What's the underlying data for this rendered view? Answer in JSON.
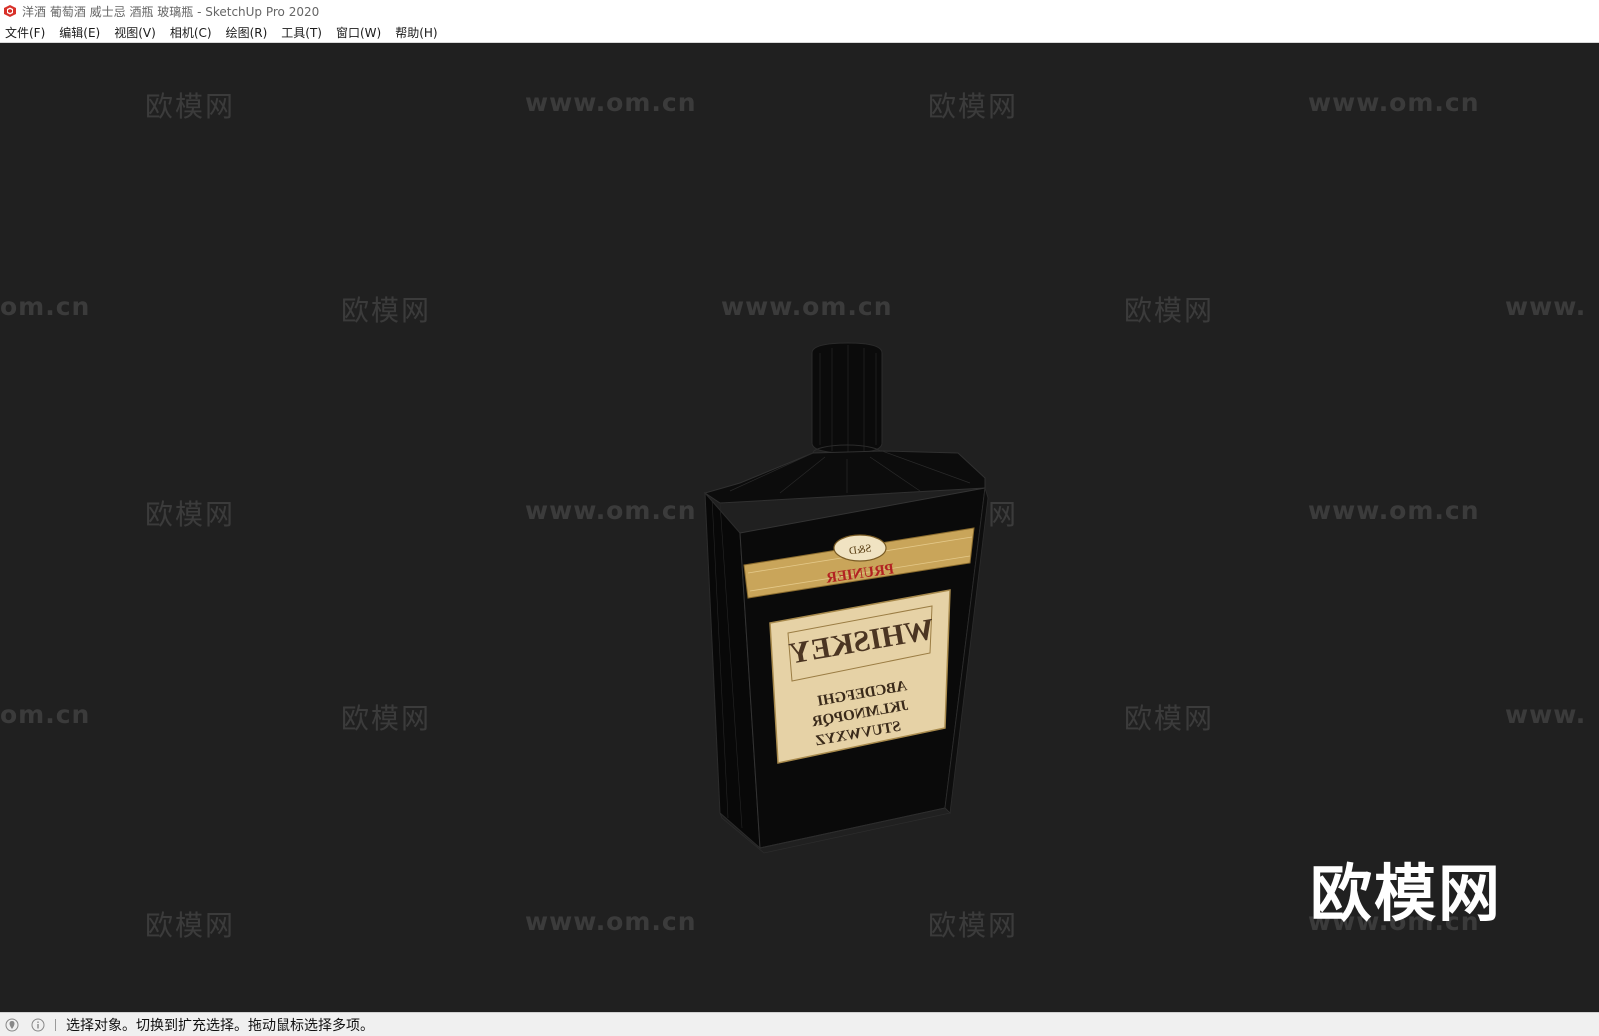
{
  "window": {
    "title": "洋酒 葡萄酒 威士忌 酒瓶 玻璃瓶 - SketchUp Pro 2020",
    "app_icon": "sketchup-icon"
  },
  "menu": [
    "文件(F)",
    "编辑(E)",
    "视图(V)",
    "相机(C)",
    "绘图(R)",
    "工具(T)",
    "窗口(W)",
    "帮助(H)"
  ],
  "watermarks": {
    "site": "www.om.cn",
    "site_clipped": "om.cn",
    "site_clipped_right": "www.",
    "brand": "欧模网",
    "brand_large": "欧模网"
  },
  "model": {
    "description": "whiskey-bottle-3d-model",
    "label_brand": "PRUNIER",
    "label_emblem": "S&D",
    "label_title": "WHISKEY",
    "label_alphabet": [
      "ABCDEFGHI",
      "JKLMNOPQR",
      "STUVWXYZ"
    ]
  },
  "status": {
    "text": "选择对象。切换到扩充选择。拖动鼠标选择多项。",
    "icons": [
      "geo-location-icon",
      "info-icon"
    ]
  },
  "colors": {
    "viewport_bg": "#202020",
    "label_gold": "#c9a55a",
    "label_cream": "#e6d2a6",
    "bottle_body": "#0a0a0a"
  }
}
